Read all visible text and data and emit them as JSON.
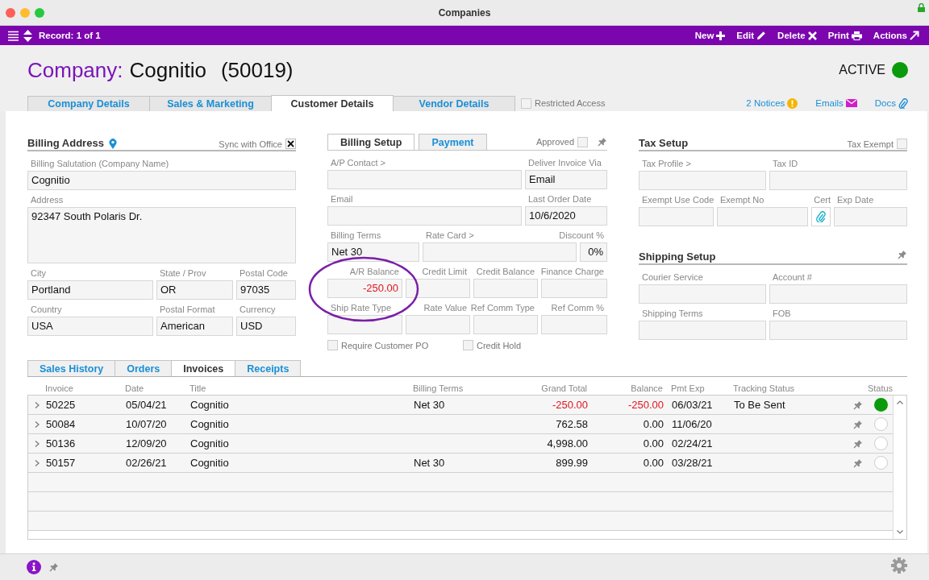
{
  "window": {
    "title": "Companies"
  },
  "toolbar": {
    "record": "Record: 1 of 1",
    "actions": [
      {
        "kind": "new",
        "label": "New"
      },
      {
        "kind": "edit",
        "label": "Edit"
      },
      {
        "kind": "delete",
        "label": "Delete"
      },
      {
        "kind": "print",
        "label": "Print"
      },
      {
        "kind": "actions",
        "label": "Actions"
      }
    ]
  },
  "header": {
    "title_label": "Company:",
    "company_name": "Cognitio",
    "company_number": "(50019)",
    "status": "ACTIVE",
    "status_on": true
  },
  "tabs": [
    {
      "label": "Company Details",
      "selected": false
    },
    {
      "label": "Sales & Marketing",
      "selected": false
    },
    {
      "label": "Customer Details",
      "selected": true
    },
    {
      "label": "Vendor Details",
      "selected": false
    }
  ],
  "restricted_access": {
    "label": "Restricted Access",
    "checked": false
  },
  "links": [
    {
      "kind": "notices",
      "label": "2 Notices"
    },
    {
      "kind": "emails",
      "label": "Emails"
    },
    {
      "kind": "docs",
      "label": "Docs"
    }
  ],
  "billing_address": {
    "title": "Billing Address",
    "sync": {
      "label": "Sync with Office",
      "checked": true
    },
    "rows": [
      [
        {
          "label": "Billing Salutation (Company Name)",
          "value": "Cognitio",
          "kind": "text"
        }
      ],
      [
        {
          "label": "Address",
          "value": "92347 South Polaris Dr.",
          "kind": "multiline"
        }
      ],
      [
        {
          "label": "City",
          "value": "Portland",
          "kind": "text"
        },
        {
          "label": "State / Prov",
          "value": "OR",
          "kind": "text"
        },
        {
          "label": "Postal Code",
          "value": "97035",
          "kind": "text"
        }
      ],
      [
        {
          "label": "Country",
          "value": "USA",
          "kind": "text"
        },
        {
          "label": "Postal Format",
          "value": "American",
          "kind": "text"
        },
        {
          "label": "Currency",
          "value": "USD",
          "kind": "text"
        }
      ]
    ]
  },
  "billing": {
    "tabs": [
      {
        "label": "Billing Setup",
        "selected": true
      },
      {
        "label": "Payment",
        "selected": false
      }
    ],
    "approved": {
      "label": "Approved",
      "checked": false
    },
    "rows": [
      [
        {
          "label": "A/P Contact >",
          "kind": "text"
        },
        {
          "label": "Deliver Invoice Via",
          "value": "Email",
          "kind": "text"
        }
      ],
      [
        {
          "label": "Email",
          "kind": "text"
        },
        {
          "label": "Last Order Date",
          "value": "10/6/2020",
          "kind": "text"
        }
      ],
      [
        {
          "label": "Billing Terms",
          "value": "Net 30",
          "kind": "text"
        },
        {
          "label": "Rate Card >",
          "kind": "text"
        },
        {
          "label": "Discount %",
          "value": "0%",
          "kind": "number"
        }
      ]
    ],
    "amount_rows": [
      [
        {
          "label": "A/R Balance",
          "value": "-250.00",
          "kind": "negative"
        },
        {
          "label": "Credit Limit",
          "kind": "number"
        },
        {
          "label": "Credit Balance",
          "kind": "number"
        },
        {
          "label": "Finance Charge",
          "kind": "number"
        }
      ],
      [
        {
          "label": "Ship Rate Type",
          "kind": "text"
        },
        {
          "label": "Rate Value",
          "kind": "number"
        },
        {
          "label": "Ref Comm Type",
          "kind": "number"
        },
        {
          "label": "Ref Comm %",
          "kind": "number"
        }
      ]
    ],
    "checkboxes": [
      {
        "label": "Require Customer PO",
        "checked": false
      },
      {
        "label": "Credit Hold",
        "checked": false
      }
    ]
  },
  "tax_setup": {
    "title": "Tax Setup",
    "tax_exempt": {
      "label": "Tax Exempt",
      "checked": false
    },
    "rows": [
      [
        {
          "label": "Tax Profile >",
          "kind": "text"
        },
        {
          "label": "Tax ID",
          "kind": "text"
        }
      ],
      [
        {
          "label": "Exempt Use Code",
          "kind": "text"
        },
        {
          "label": "Exempt No",
          "kind": "text"
        },
        {
          "label": "Cert",
          "kind": "attachment"
        },
        {
          "label": "Exp Date",
          "kind": "text"
        }
      ]
    ]
  },
  "shipping_setup": {
    "title": "Shipping Setup",
    "rows": [
      [
        {
          "label": "Courier Service",
          "kind": "text"
        },
        {
          "label": "Account #",
          "kind": "text"
        }
      ],
      [
        {
          "label": "Shipping Terms",
          "kind": "text"
        },
        {
          "label": "FOB",
          "kind": "text"
        }
      ]
    ]
  },
  "invoice_tabs": [
    {
      "label": "Sales History",
      "selected": false
    },
    {
      "label": "Orders",
      "selected": false
    },
    {
      "label": "Invoices",
      "selected": true
    },
    {
      "label": "Receipts",
      "selected": false
    }
  ],
  "invoices": {
    "columns": [
      "Invoice",
      "Date",
      "Title",
      "Billing Terms",
      "Grand Total",
      "Balance",
      "Pmt Exp",
      "Tracking Status",
      "Status"
    ],
    "rows": [
      {
        "invoice": "50225",
        "date": "05/04/21",
        "title": "Cognitio",
        "billing_terms": "Net 30",
        "grand_total": "-250.00",
        "balance": "-250.00",
        "pmt_exp": "06/03/21",
        "tracking_status": "To Be Sent",
        "negative": true,
        "status_on": true
      },
      {
        "invoice": "50084",
        "date": "10/07/20",
        "title": "Cognitio",
        "grand_total": "762.58",
        "balance": "0.00",
        "pmt_exp": "11/06/20",
        "negative": false,
        "status_on": false
      },
      {
        "invoice": "50136",
        "date": "12/09/20",
        "title": "Cognitio",
        "grand_total": "4,998.00",
        "balance": "0.00",
        "pmt_exp": "02/24/21",
        "negative": false,
        "status_on": false
      },
      {
        "invoice": "50157",
        "date": "02/26/21",
        "title": "Cognitio",
        "billing_terms": "Net 30",
        "grand_total": "899.99",
        "balance": "0.00",
        "pmt_exp": "03/28/21",
        "negative": false,
        "status_on": false
      }
    ]
  }
}
